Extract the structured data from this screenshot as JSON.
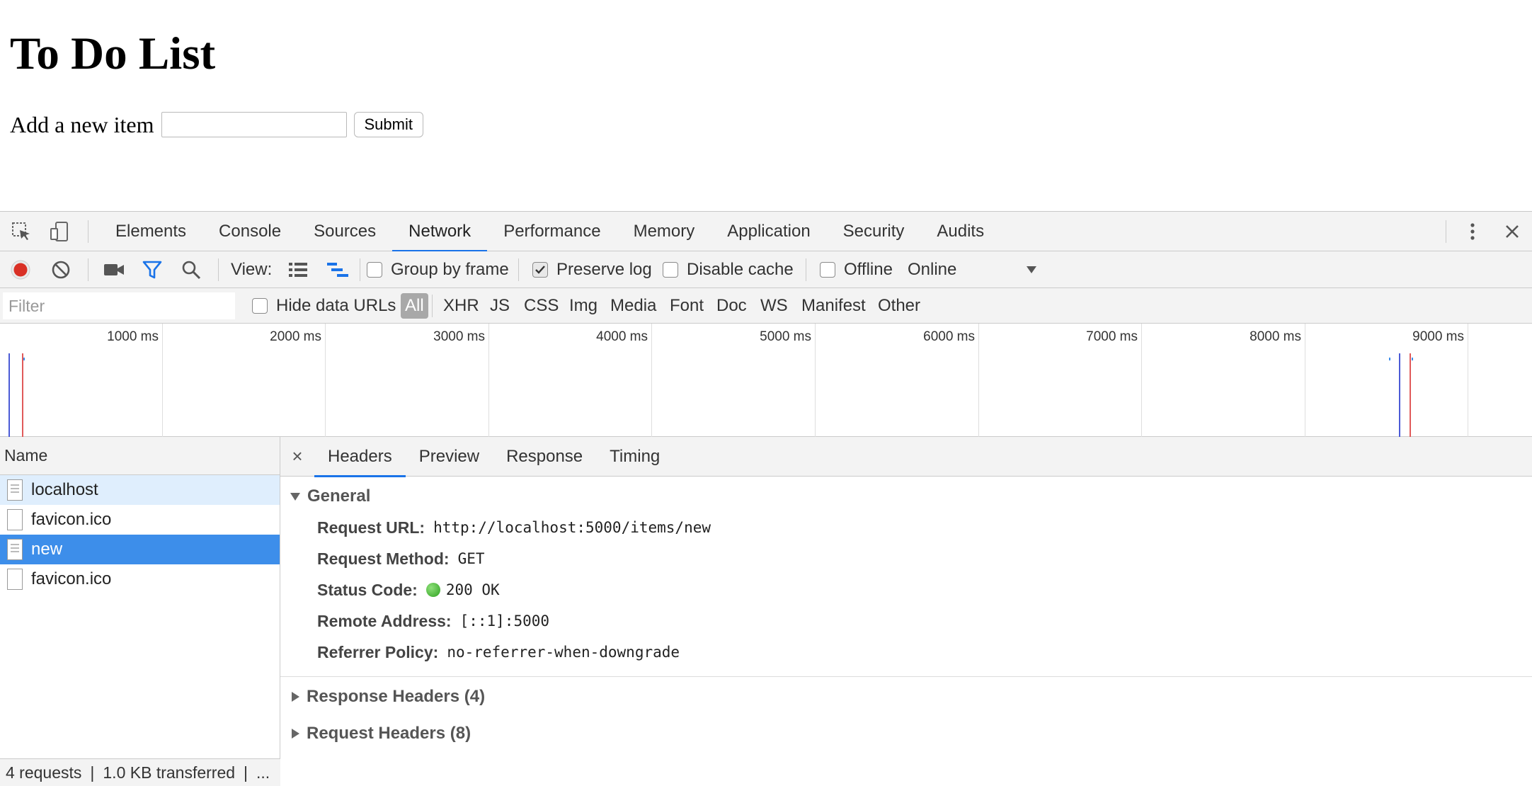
{
  "page": {
    "title": "To Do List",
    "form_label": "Add a new item",
    "input_value": "",
    "submit_label": "Submit"
  },
  "devtools": {
    "tabs": [
      "Elements",
      "Console",
      "Sources",
      "Network",
      "Performance",
      "Memory",
      "Application",
      "Security",
      "Audits"
    ],
    "active_tab": "Network",
    "toolbar": {
      "view_label": "View:",
      "group_by_frame": "Group by frame",
      "preserve_log": "Preserve log",
      "disable_cache": "Disable cache",
      "offline": "Offline",
      "throttle": "Online"
    },
    "filter": {
      "placeholder": "Filter",
      "hide_data_urls": "Hide data URLs",
      "types": [
        "All",
        "XHR",
        "JS",
        "CSS",
        "Img",
        "Media",
        "Font",
        "Doc",
        "WS",
        "Manifest",
        "Other"
      ]
    },
    "overview_ticks": [
      "1000 ms",
      "2000 ms",
      "3000 ms",
      "4000 ms",
      "5000 ms",
      "6000 ms",
      "7000 ms",
      "8000 ms",
      "9000 ms"
    ],
    "requests": {
      "column_name": "Name",
      "items": [
        {
          "name": "localhost",
          "state": "hover"
        },
        {
          "name": "favicon.ico",
          "state": ""
        },
        {
          "name": "new",
          "state": "selected"
        },
        {
          "name": "favicon.ico",
          "state": ""
        }
      ],
      "summary_count": "4 requests",
      "summary_transferred": "1.0 KB transferred",
      "summary_more": "..."
    },
    "detail": {
      "close": "×",
      "tabs": [
        "Headers",
        "Preview",
        "Response",
        "Timing"
      ],
      "active_tab": "Headers",
      "general_title": "General",
      "general": [
        {
          "key": "Request URL:",
          "value": "http://localhost:5000/items/new"
        },
        {
          "key": "Request Method:",
          "value": "GET"
        },
        {
          "key": "Status Code:",
          "value": "200 OK"
        },
        {
          "key": "Remote Address:",
          "value": "[::1]:5000"
        },
        {
          "key": "Referrer Policy:",
          "value": "no-referrer-when-downgrade"
        }
      ],
      "response_headers": "Response Headers (4)",
      "request_headers": "Request Headers (8)"
    },
    "colors": {
      "accent": "#1a73e8",
      "record": "#d93025",
      "selected_row": "#3d8eea"
    }
  }
}
